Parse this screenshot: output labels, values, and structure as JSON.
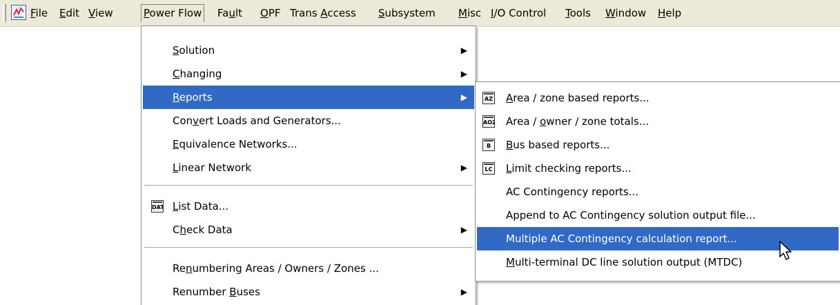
{
  "menubar": {
    "items": [
      {
        "pre": "",
        "u": "F",
        "post": "ile"
      },
      {
        "pre": "",
        "u": "E",
        "post": "dit"
      },
      {
        "pre": "",
        "u": "V",
        "post": "iew"
      },
      {
        "pre": "",
        "u": "P",
        "post": "ower Flow"
      },
      {
        "pre": "Fa",
        "u": "u",
        "post": "lt"
      },
      {
        "pre": "",
        "u": "O",
        "post": "PF"
      },
      {
        "pre": "Trans ",
        "u": "A",
        "post": "ccess"
      },
      {
        "pre": "",
        "u": "S",
        "post": "ubsystem"
      },
      {
        "pre": "",
        "u": "M",
        "post": "isc"
      },
      {
        "pre": "",
        "u": "I",
        "post": "/O Control"
      },
      {
        "pre": "",
        "u": "T",
        "post": "ools"
      },
      {
        "pre": "",
        "u": "W",
        "post": "indow"
      },
      {
        "pre": "",
        "u": "H",
        "post": "elp"
      }
    ]
  },
  "power_flow_menu": {
    "items": [
      {
        "pre": "",
        "u": "S",
        "post": "olution"
      },
      {
        "pre": "",
        "u": "C",
        "post": "hanging"
      },
      {
        "pre": "",
        "u": "R",
        "post": "eports"
      },
      {
        "pre": "Con",
        "u": "v",
        "post": "ert Loads and Generators..."
      },
      {
        "pre": "",
        "u": "E",
        "post": "quivalence Networks..."
      },
      {
        "pre": "",
        "u": "L",
        "post": "inear Network"
      },
      {
        "pre": "",
        "u": "L",
        "post": "ist Data...",
        "icon": "DAT"
      },
      {
        "pre": "C",
        "u": "h",
        "post": "eck Data"
      },
      {
        "pre": "Re",
        "u": "n",
        "post": "umbering Areas / Owners / Zones ..."
      },
      {
        "pre": "Renumber ",
        "u": "B",
        "post": "uses"
      }
    ]
  },
  "reports_menu": {
    "items": [
      {
        "pre": "",
        "u": "A",
        "post": "rea / zone based reports...",
        "icon": "AZ"
      },
      {
        "pre": "Area / ",
        "u": "o",
        "post": "wner / zone totals...",
        "icon": "AOZ"
      },
      {
        "pre": "",
        "u": "B",
        "post": "us based reports...",
        "icon": "B"
      },
      {
        "pre": "",
        "u": "L",
        "post": "imit checking reports...",
        "icon": "LC"
      },
      {
        "pre": "AC Contingency reports...",
        "u": "",
        "post": ""
      },
      {
        "pre": "Append to AC Contingency solution output file...",
        "u": "",
        "post": ""
      },
      {
        "pre": "Multiple AC Contingency calculation report...",
        "u": "",
        "post": ""
      },
      {
        "pre": "",
        "u": "M",
        "post": "ulti-terminal DC line solution output (MTDC)"
      }
    ]
  },
  "colors": {
    "highlight": "#316ac5",
    "menubar_bg": "#ece9d8"
  }
}
